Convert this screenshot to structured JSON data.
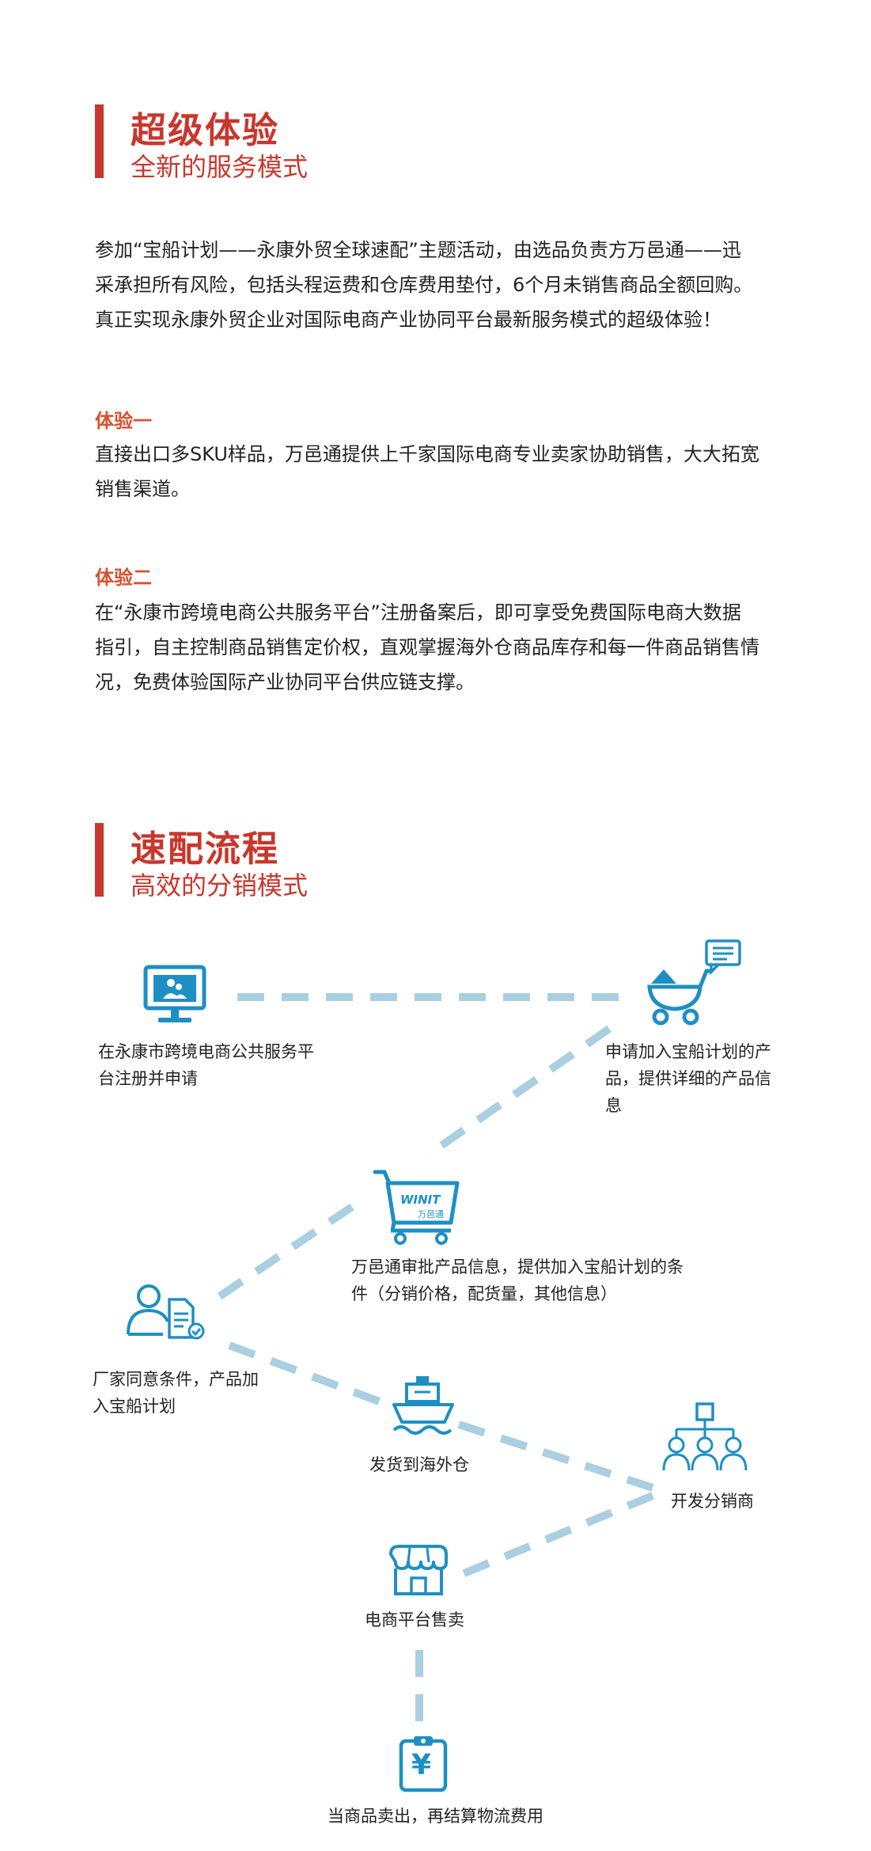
{
  "section1": {
    "title": "超级体验",
    "subtitle": "全新的服务模式",
    "intro": "参加“宝船计划——永康外贸全球速配”主题活动，由选品负责方万邑通——迅采承担所有风险，包括头程运费和仓库费用垫付，6个月未销售商品全额回购。真正实现永康外贸企业对国际电商产业协同平台最新服务模式的超级体验！",
    "exp1_label": "体验一",
    "exp1_text": "直接出口多SKU样品，万邑通提供上千家国际电商专业卖家协助销售，大大拓宽销售渠道。",
    "exp2_label": "体验二",
    "exp2_text": "在“永康市跨境电商公共服务平台”注册备案后，即可享受免费国际电商大数据指引，自主控制商品销售定价权，直观掌握海外仓商品库存和每一件商品销售情况，免费体验国际产业协同平台供应链支撑。"
  },
  "section2": {
    "title": "速配流程",
    "subtitle": "高效的分销模式"
  },
  "flow": {
    "step1": "在永康市跨境电商公共服务平台注册并申请",
    "step2": "申请加入宝船计划的产品，提供详细的产品信息",
    "step3": "万邑通审批产品信息，提供加入宝船计划的条件（分销价格，配货量，其他信息）",
    "step3_logo_en": "WINIT",
    "step3_logo_cn": "万邑通",
    "step4": "厂家同意条件，产品加入宝船计划",
    "step5": "发货到海外仓",
    "step6": "开发分销商",
    "step7": "电商平台售卖",
    "step8": "当商品卖出，再结算物流费用",
    "step8_icon_glyph": "¥",
    "colors": {
      "icon": "#1e8fc4",
      "line": "#a9cfe0",
      "accent": "#c8372d"
    }
  }
}
